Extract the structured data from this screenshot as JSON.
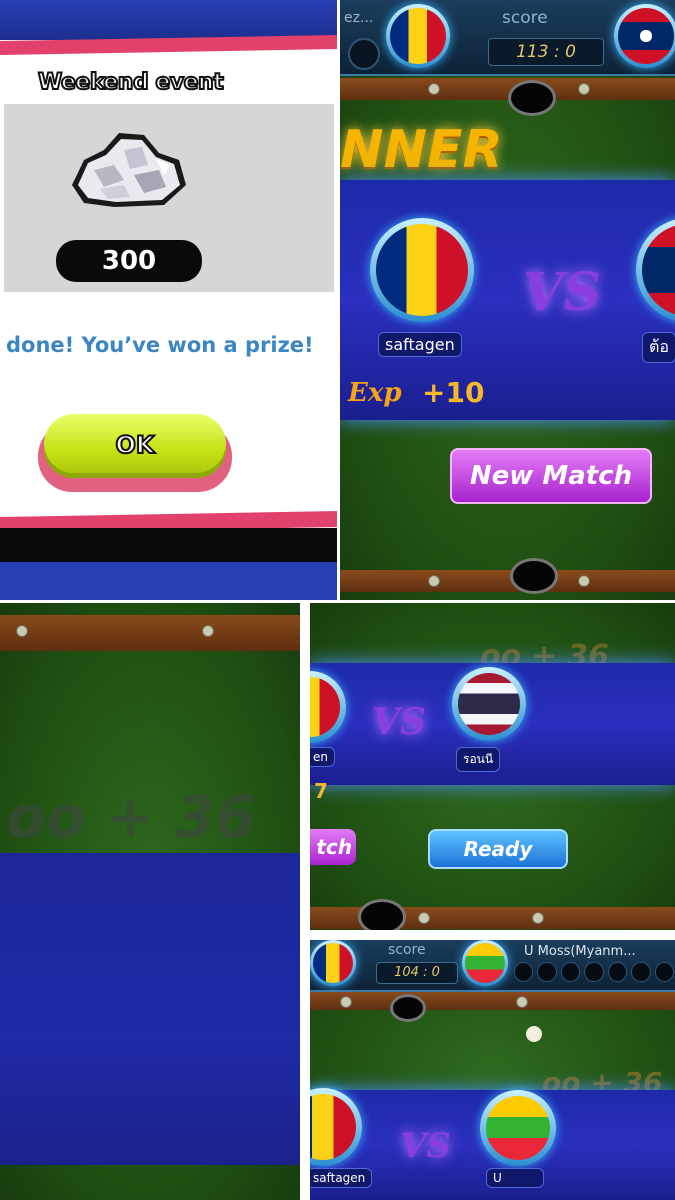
{
  "reward_popup": {
    "title": "Weekend event",
    "amount": "300",
    "message": "done! You’ve won a prize!",
    "ok_label": "OK"
  },
  "winner_screen": {
    "truncated_name": "ez...",
    "score_label": "score",
    "score": "113 : 0",
    "banner_text": "NNER",
    "player_name": "saftagen",
    "opponent_name": "ต้อ",
    "vs": "VS",
    "exp_label": "Exp",
    "exp_value": "+10",
    "new_match_label": "New Match"
  },
  "blurred_panel": {
    "faded_text": "oo + 36"
  },
  "ready_screen": {
    "faded_text": "oo + 36",
    "player_name": "en",
    "opponent_name": "รอนนี",
    "exp_value": "7",
    "match_label": "tch",
    "ready_label": "Ready",
    "vs": "VS"
  },
  "myanmar_screen": {
    "score_label": "score",
    "score": "104 : 0",
    "opponent_header": "U Moss(Myanm...",
    "faded_text": "oo + 36",
    "player_name": "saftagen",
    "opponent_name": "U",
    "vs": "VS"
  }
}
